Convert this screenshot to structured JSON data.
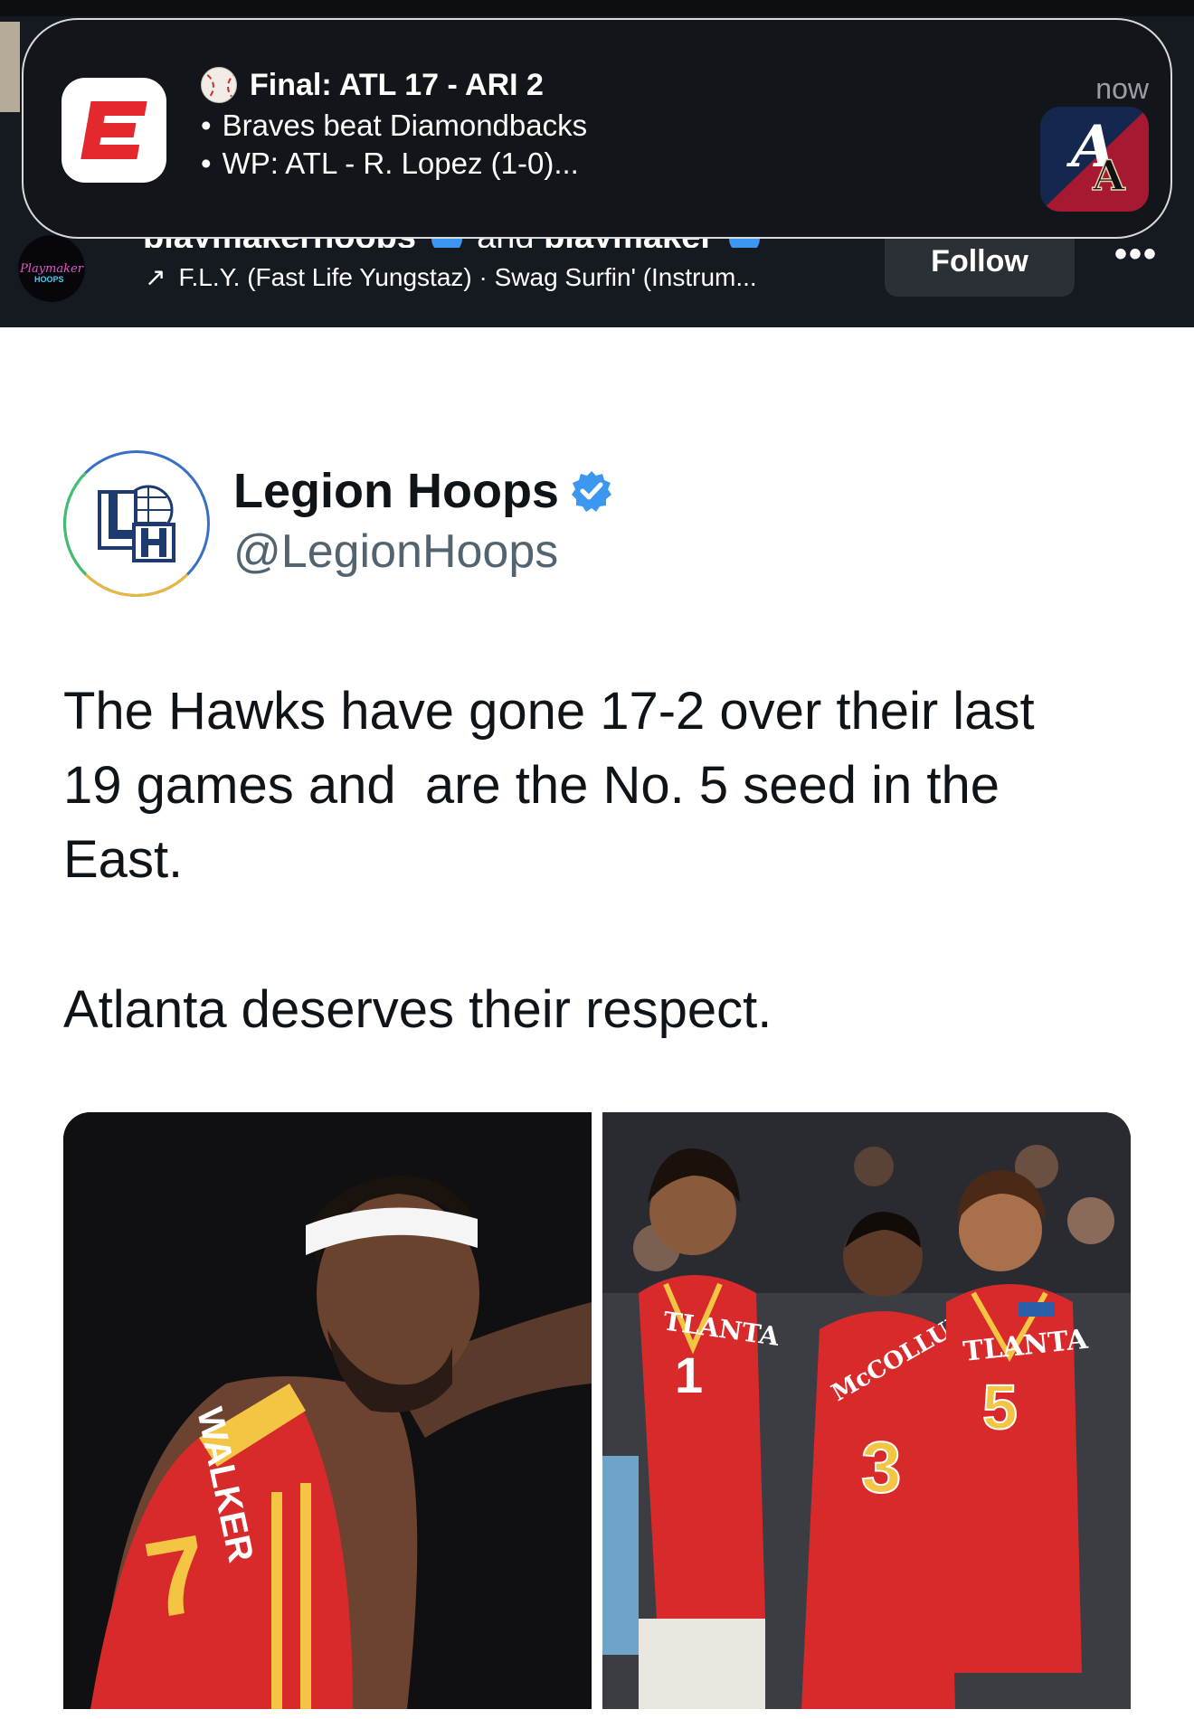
{
  "notification": {
    "app_icon": "espn-icon",
    "title": "Final: ATL 17 - ARI 2",
    "title_icon": "baseball-icon",
    "lines": [
      "Braves beat Diamondbacks",
      "WP: ATL - R. Lopez (1-0)..."
    ],
    "bullet": "•",
    "time": "now",
    "thumbnail": "braves-diamondbacks-logo"
  },
  "instagram": {
    "account_primary": "playmakerhoops",
    "and_text": "and",
    "account_secondary": "playmaker",
    "avatar_text": "Playmaker",
    "avatar_sub": "HOOPS",
    "audio_arrow": "↗",
    "audio": "F.L.Y. (Fast Life Yungstaz) · Swag Surfin' (Instrum...",
    "follow_label": "Follow",
    "more_label": "•••"
  },
  "tweet": {
    "display_name": "Legion Hoops",
    "handle": "@LegionHoops",
    "verified": true,
    "avatar_monogram": "LH",
    "text_p1": "The Hawks have gone 17-2 over their last\n19 games and  are the No. 5 seed in the\nEast.",
    "text_p2": "Atlanta deserves their respect.",
    "media": [
      {
        "description": "Hawks player in red jersey pointing",
        "jersey_text": "WALKER",
        "number": "7"
      },
      {
        "description": "Three Hawks players in red jerseys",
        "jersey_text": [
          "ATLANTA",
          "McCOLLUM",
          "ATLANTA"
        ],
        "numbers": [
          "1",
          "3",
          "5"
        ]
      }
    ]
  },
  "colors": {
    "header_bg": "#151a20",
    "espn_red": "#e3282e",
    "verified_blue": "#3b97f0",
    "hawks_red": "#d82a2a"
  }
}
